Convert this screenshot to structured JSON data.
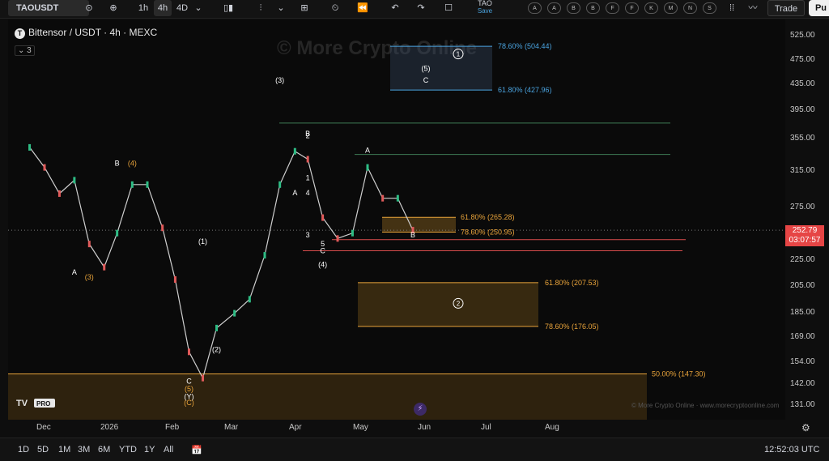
{
  "toolbar": {
    "symbol": "TAOUSDT",
    "timeframes": [
      "1h",
      "4h",
      "4D"
    ],
    "active_timeframe": "4h",
    "save_top": "TAO",
    "save_label": "Save",
    "pills": [
      "A",
      "A",
      "B",
      "B",
      "F",
      "F",
      "K",
      "M",
      "N",
      "S"
    ],
    "trade_label": "Trade",
    "publish_label": "Pu"
  },
  "legend": {
    "title": "Bittensor / USDT · 4h · MEXC",
    "logo_letter": "T",
    "indicators_count": "3"
  },
  "watermark": "© More Crypto Online",
  "watermark_footer": "© More Crypto Online  ·  www.morecryptoonline.com",
  "price_scale": {
    "ticks": [
      "525.00",
      "475.00",
      "435.00",
      "395.00",
      "355.00",
      "315.00",
      "275.00",
      "225.00",
      "205.00",
      "185.00",
      "169.00",
      "154.00",
      "142.00",
      "131.00"
    ],
    "current_price": "252.79",
    "countdown": "03:07:57"
  },
  "time_axis": {
    "labels": [
      "Dec",
      "2026",
      "Feb",
      "Mar",
      "Apr",
      "May",
      "Jun",
      "Jul",
      "Aug"
    ]
  },
  "bottom_bar": {
    "ranges": [
      "1D",
      "5D",
      "1M",
      "3M",
      "6M",
      "YTD",
      "1Y",
      "All"
    ],
    "clock": "12:52:03 UTC"
  },
  "chart_data": {
    "type": "candlestick",
    "title": "Bittensor / USDT · 4h · MEXC",
    "xlabel": "",
    "ylabel": "",
    "log_scale": true,
    "grid": false,
    "series": [
      {
        "values_note": "",
        "dates": [
          "Nov 24",
          "Dec 1",
          "Dec 8",
          "Dec 15",
          "Dec 22",
          "Dec 29",
          "Jan 5",
          "Jan 12",
          "Jan 19",
          "Jan 26",
          "Feb 2",
          "Feb 9",
          "Feb 16",
          "Feb 23",
          "Mar 2",
          "Mar 9",
          "Mar 16",
          "Mar 23",
          "Mar 30",
          "Apr 6",
          "Apr 13",
          "Apr 20",
          "Apr 27",
          "May 4",
          "May 11",
          "May 18",
          "May 25"
        ],
        "close": [
          345,
          320,
          290,
          305,
          240,
          220,
          250,
          300,
          300,
          255,
          210,
          160,
          145,
          175,
          185,
          195,
          230,
          300,
          340,
          330,
          265,
          245,
          250,
          320,
          285,
          285,
          252.79
        ]
      }
    ],
    "fib_levels": [
      {
        "label": "78.60% (504.44)",
        "value": 504.44,
        "color": "#4aa3df"
      },
      {
        "label": "61.80% (427.96)",
        "value": 427.96,
        "color": "#4aa3df"
      },
      {
        "label": "61.80% (265.28)",
        "value": 265.28,
        "color": "#e8a33a"
      },
      {
        "label": "78.60% (250.95)",
        "value": 250.95,
        "color": "#e8a33a"
      },
      {
        "label": "61.80% (207.53)",
        "value": 207.53,
        "color": "#e8a33a"
      },
      {
        "label": "78.60% (176.05)",
        "value": 176.05,
        "color": "#e8a33a"
      },
      {
        "label": "50.00% (147.30)",
        "value": 147.3,
        "color": "#e8a33a"
      }
    ],
    "horizontal_lines": [
      {
        "value": 378,
        "color": "#3e7a55"
      },
      {
        "value": 336,
        "color": "#3e7a55"
      },
      {
        "value": 244,
        "color": "#d94c4c"
      },
      {
        "value": 234,
        "color": "#d94c4c"
      }
    ],
    "wave_labels": [
      {
        "text": "(3)",
        "date": "Mar 23",
        "price": 440,
        "color": "#ffffff"
      },
      {
        "text": "B",
        "date": "Jan 5",
        "price": 322,
        "color": "#ffffff"
      },
      {
        "text": "(4)",
        "date": "Jan 12",
        "price": 322,
        "color": "#e8a33a"
      },
      {
        "text": "A",
        "date": "Dec 15",
        "price": 214,
        "color": "#ffffff"
      },
      {
        "text": "(3)",
        "date": "Dec 22",
        "price": 210,
        "color": "#e8a33a"
      },
      {
        "text": "(1)",
        "date": "Feb 16",
        "price": 240,
        "color": "#ffffff"
      },
      {
        "text": "(2)",
        "date": "Feb 23",
        "price": 160,
        "color": "#ffffff"
      },
      {
        "text": "C",
        "date": "Feb 9",
        "price": 142,
        "color": "#ffffff"
      },
      {
        "text": "(5)",
        "date": "Feb 9",
        "price": 138,
        "color": "#e8a33a"
      },
      {
        "text": "(Y)",
        "date": "Feb 9",
        "price": 134,
        "color": "#ffffff"
      },
      {
        "text": "(C)",
        "date": "Feb 9",
        "price": 131,
        "color": "#e8a33a"
      },
      {
        "text": "A",
        "date": "Mar 30",
        "price": 288,
        "color": "#ffffff"
      },
      {
        "text": "B",
        "date": "Apr 6",
        "price": 360,
        "color": "#ffffff"
      },
      {
        "text": "1",
        "date": "Apr 6",
        "price": 305,
        "color": "#ffffff"
      },
      {
        "text": "2",
        "date": "Apr 6",
        "price": 357,
        "color": "#ffffff"
      },
      {
        "text": "4",
        "date": "Apr 6",
        "price": 288,
        "color": "#ffffff"
      },
      {
        "text": "3",
        "date": "Apr 6",
        "price": 246,
        "color": "#ffffff"
      },
      {
        "text": "5",
        "date": "Apr 13",
        "price": 238,
        "color": "#ffffff"
      },
      {
        "text": "C",
        "date": "Apr 13",
        "price": 232,
        "color": "#ffffff"
      },
      {
        "text": "(4)",
        "date": "Apr 13",
        "price": 220,
        "color": "#ffffff"
      },
      {
        "text": "A",
        "date": "May 4",
        "price": 338,
        "color": "#ffffff"
      },
      {
        "text": "B",
        "date": "May 25",
        "price": 246,
        "color": "#ffffff"
      },
      {
        "text": "(5)",
        "date": "Jun 1",
        "price": 460,
        "color": "#ffffff"
      },
      {
        "text": "C",
        "date": "Jun 1",
        "price": 440,
        "color": "#ffffff"
      }
    ],
    "circled_labels": [
      {
        "text": "1",
        "date": "Jun 1",
        "price": 490
      },
      {
        "text": "2",
        "date": "Jun 1",
        "price": 192
      }
    ]
  }
}
